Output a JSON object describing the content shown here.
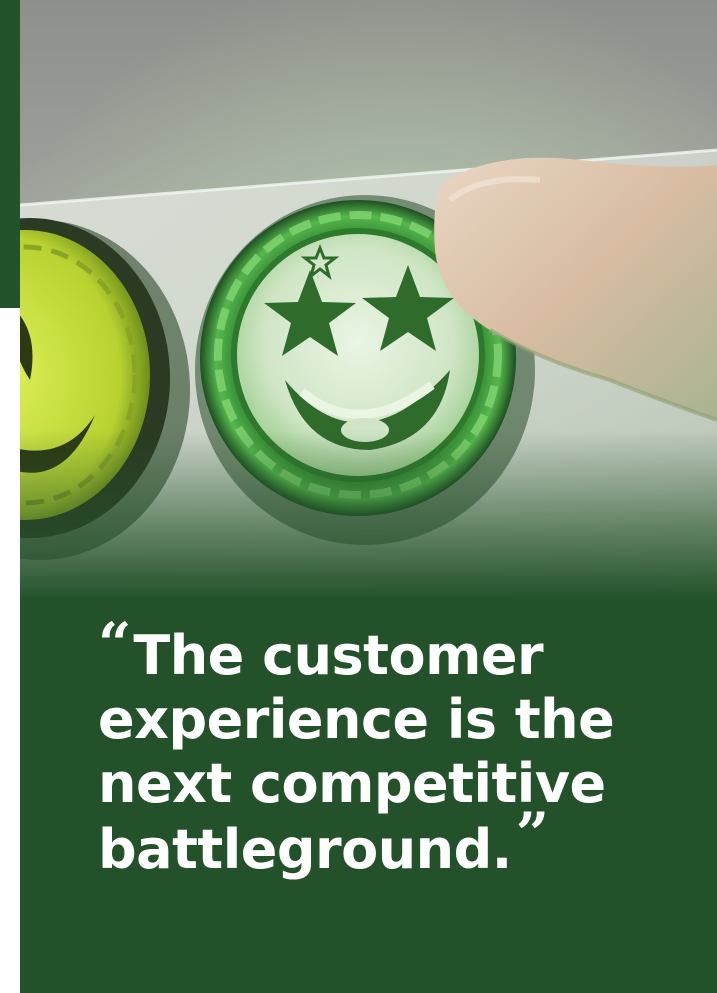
{
  "quote": {
    "open_mark": "“",
    "text": "The customer experience is the next competitive battleground.",
    "close_mark": "”"
  },
  "colors": {
    "panel_green": "#23522a",
    "text": "#ffffff",
    "button_green": "#3f9b3a",
    "button_yellow": "#b8d230"
  },
  "photo": {
    "subject": "finger pressing a glowing green star-eyed smiley button beside a yellow smiley button",
    "icons": [
      "star-eyes-smiley-icon",
      "happy-smiley-icon"
    ]
  }
}
